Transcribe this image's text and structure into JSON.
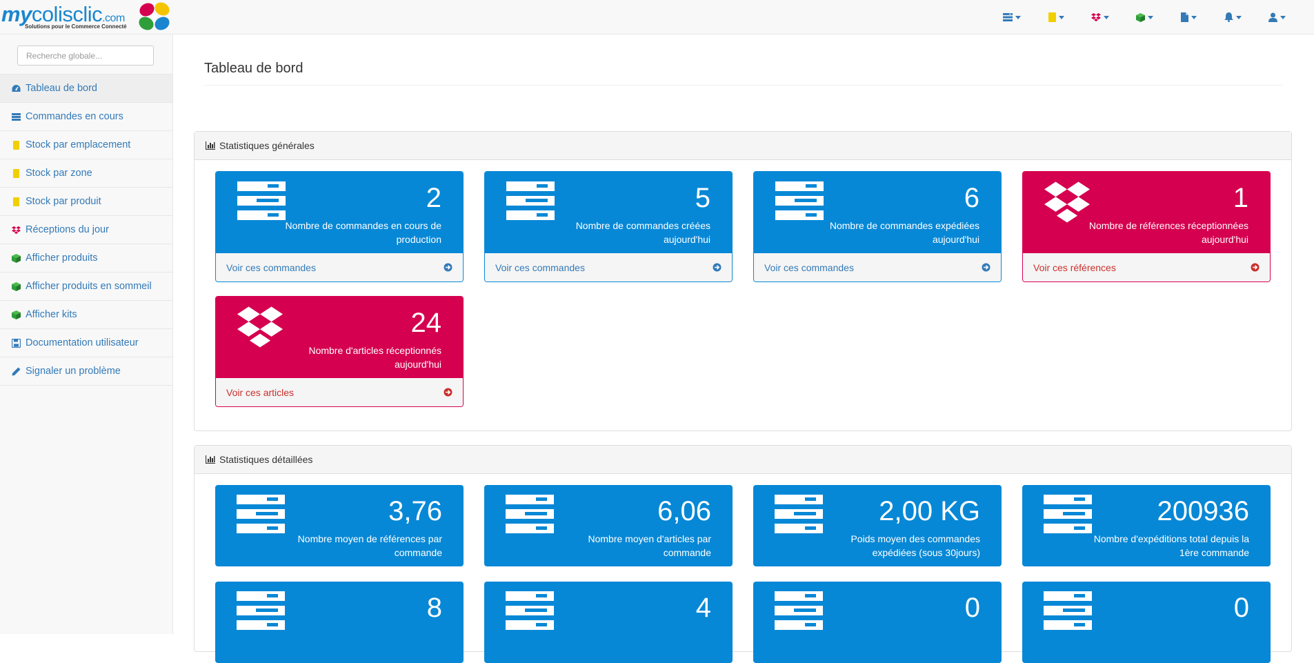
{
  "logo": {
    "my": "my",
    "name": "colisclic",
    "tld": ".com",
    "tagline": "Solutions pour le Commerce Connecté"
  },
  "navbar": {
    "icons": [
      {
        "name": "orders-menu-icon",
        "color": "#337ab7"
      },
      {
        "name": "stock-menu-icon",
        "color": "#f0d000"
      },
      {
        "name": "receptions-menu-icon",
        "color": "#d5004f"
      },
      {
        "name": "products-menu-icon",
        "color": "#2e9e3a"
      },
      {
        "name": "documents-menu-icon",
        "color": "#337ab7"
      },
      {
        "name": "notifications-menu-icon",
        "color": "#337ab7"
      },
      {
        "name": "user-menu-icon",
        "color": "#337ab7"
      }
    ]
  },
  "search": {
    "placeholder": "Recherche globale..."
  },
  "sidebar": {
    "items": [
      {
        "label": "Tableau de bord",
        "icon": "dashboard-icon"
      },
      {
        "label": "Commandes en cours",
        "icon": "orders-icon"
      },
      {
        "label": "Stock par emplacement",
        "icon": "stock-icon"
      },
      {
        "label": "Stock par zone",
        "icon": "stock-icon"
      },
      {
        "label": "Stock par produit",
        "icon": "stock-icon"
      },
      {
        "label": "Réceptions du jour",
        "icon": "dropbox-icon"
      },
      {
        "label": "Afficher produits",
        "icon": "cube-icon"
      },
      {
        "label": "Afficher produits en sommeil",
        "icon": "cube-icon"
      },
      {
        "label": "Afficher kits",
        "icon": "cube-icon"
      },
      {
        "label": "Documentation utilisateur",
        "icon": "save-icon"
      },
      {
        "label": "Signaler un problème",
        "icon": "pencil-icon"
      }
    ]
  },
  "page": {
    "title": "Tableau de bord"
  },
  "general": {
    "heading": "Statistiques générales",
    "cards": [
      {
        "value": "2",
        "label": "Nombre de commandes en cours de production",
        "link": "Voir ces commandes",
        "color": "#0788d6"
      },
      {
        "value": "5",
        "label": "Nombre de commandes créées aujourd'hui",
        "link": "Voir ces commandes",
        "color": "#0788d6"
      },
      {
        "value": "6",
        "label": "Nombre de commandes expédiées aujourd'hui",
        "link": "Voir ces commandes",
        "color": "#0788d6"
      },
      {
        "value": "1",
        "label": "Nombre de références réceptionnées aujourd'hui",
        "link": "Voir ces références",
        "color": "#d5004f"
      },
      {
        "value": "24",
        "label": "Nombre d'articles réceptionnés aujourd'hui",
        "link": "Voir ces articles",
        "color": "#d5004f"
      }
    ]
  },
  "detailed": {
    "heading": "Statistiques détaillées",
    "cards": [
      {
        "value": "3,76",
        "label": "Nombre moyen de références par commande"
      },
      {
        "value": "6,06",
        "label": "Nombre moyen d'articles par commande"
      },
      {
        "value": "2,00 KG",
        "label": "Poids moyen des commandes expédiées (sous 30jours)"
      },
      {
        "value": "200936",
        "label": "Nombre d'expéditions total depuis la 1ère commande"
      },
      {
        "value": "8",
        "label": ""
      },
      {
        "value": "4",
        "label": ""
      },
      {
        "value": "0",
        "label": ""
      },
      {
        "value": "0",
        "label": ""
      }
    ]
  }
}
